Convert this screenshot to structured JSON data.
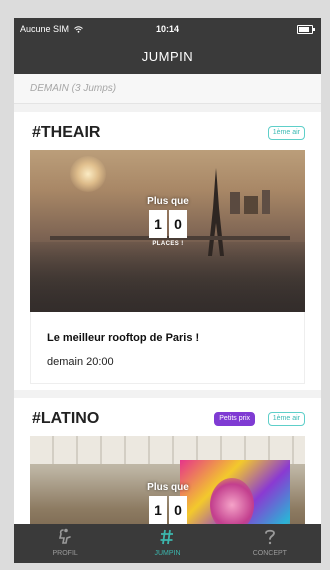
{
  "status_bar": {
    "carrier": "Aucune SIM",
    "time": "10:14"
  },
  "nav": {
    "title": "JUMPIN"
  },
  "section": {
    "header": "DEMAIN (3 Jumps)"
  },
  "cards": [
    {
      "title": "#THEAIR",
      "badges": [
        "1ème air"
      ],
      "places_label": "Plus que",
      "digits": [
        "1",
        "0"
      ],
      "places_suffix": "PLACES !",
      "description": "Le meilleur rooftop de Paris !",
      "time": "demain 20:00"
    },
    {
      "title": "#LATINO",
      "badges": [
        "Petits prix",
        "1ème air"
      ],
      "places_label": "Plus que",
      "digits": [
        "1",
        "0"
      ]
    }
  ],
  "tabs": [
    {
      "label": "PROFIL",
      "icon": "profile-icon",
      "active": false
    },
    {
      "label": "JUMPIN",
      "icon": "hashtag-icon",
      "active": true
    },
    {
      "label": "CONCEPT",
      "icon": "question-icon",
      "active": false
    }
  ],
  "colors": {
    "bar": "#3a3a3a",
    "accent": "#3cb6ad",
    "purple": "#7f3bd3"
  }
}
